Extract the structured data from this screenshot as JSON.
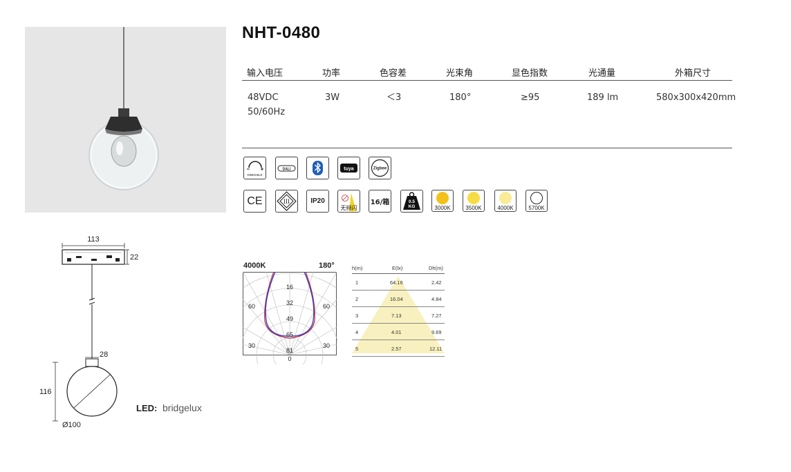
{
  "product": {
    "model": "NHT-0480"
  },
  "specs": {
    "headers": [
      "输入电压",
      "功率",
      "色容差",
      "光束角",
      "显色指数",
      "光通量",
      "外箱尺寸"
    ],
    "values": [
      "48VDC\n50/60Hz",
      "3W",
      "＜3",
      "180°",
      "≥95",
      "189 lm",
      "580x300x420mm"
    ]
  },
  "icons": {
    "row1": [
      "DIMMABLE",
      "DALI",
      "bluetooth",
      "tuya",
      "Zigbee"
    ],
    "ce": "CE",
    "class3": "III",
    "ip": "IP20",
    "flicker": "无频闪",
    "pack": "16/箱",
    "weight": "0.5\nKG",
    "cct": [
      {
        "label": "3000K",
        "color": "#f2c21a"
      },
      {
        "label": "3500K",
        "color": "#f7dc45"
      },
      {
        "label": "4000K",
        "color": "#faeb98"
      },
      {
        "label": "5700K",
        "color": "#ffffff"
      }
    ]
  },
  "drawing": {
    "width": "113",
    "canopy_height": "22",
    "neck": "28",
    "height": "116",
    "diameter": "Ø100"
  },
  "led": {
    "label": "LED:",
    "brand": "bridgelux"
  },
  "polar": {
    "cct": "4000K",
    "angle": "180°",
    "rings": [
      "16",
      "32",
      "49",
      "65",
      "81"
    ],
    "zero": "0",
    "left_labels": [
      "60",
      "30"
    ],
    "right_labels": [
      "60",
      "30"
    ]
  },
  "illuminance": {
    "headers": [
      "h(m)",
      "E(lx)",
      "Dh(m)"
    ],
    "rows": [
      [
        "1",
        "64.16",
        "2.42"
      ],
      [
        "2",
        "16.04",
        "4.84"
      ],
      [
        "3",
        "7.13",
        "7.27"
      ],
      [
        "4",
        "4.01",
        "9.69"
      ],
      [
        "5",
        "2.57",
        "12.11"
      ]
    ]
  }
}
